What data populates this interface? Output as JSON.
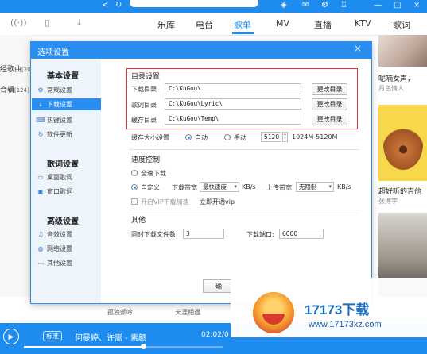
{
  "app": {
    "nav_tabs": [
      {
        "label": "乐库"
      },
      {
        "label": "电台"
      },
      {
        "label": "歌单",
        "active": true
      },
      {
        "label": "MV"
      },
      {
        "label": "直播"
      },
      {
        "label": "KTV"
      },
      {
        "label": "歌词"
      }
    ],
    "left_fragments": [
      "经歌曲",
      "合辑"
    ],
    "left_counts": [
      "[20",
      "[124]"
    ],
    "right_captions": [
      {
        "title": "呢喃女声，",
        "sub": "月色情人"
      },
      {
        "title": "超好听的吉他",
        "sub": "张博宇"
      },
      {
        "title": "",
        "sub": ""
      }
    ],
    "footer_texts": [
      "孤独颤吟",
      "天涯相遇"
    ],
    "player": {
      "quality": "标准",
      "song": "何曼婷、许嵩 - 素颜",
      "time": "02:02/0",
      "progress": 0.6
    },
    "colors": {
      "brand_blue": "#2a8ef0",
      "highlight_red": "#e53935"
    }
  },
  "dialog": {
    "title": "选项设置",
    "close_icon": "×",
    "nav_groups": [
      {
        "title": "基本设置",
        "items": [
          {
            "icon": "gear-icon",
            "label": "常规设置",
            "active": false
          },
          {
            "icon": "download-icon",
            "label": "下载设置",
            "active": true
          },
          {
            "icon": "keyboard-icon",
            "label": "热键设置",
            "active": false
          },
          {
            "icon": "refresh-icon",
            "label": "软件更新",
            "active": false
          }
        ]
      },
      {
        "title": "歌词设置",
        "items": [
          {
            "icon": "desktop-lyrics-icon",
            "label": "桌面歌词",
            "active": false
          },
          {
            "icon": "window-lyrics-icon",
            "label": "窗口歌词",
            "active": false
          }
        ]
      },
      {
        "title": "高级设置",
        "items": [
          {
            "icon": "audio-icon",
            "label": "音效设置",
            "active": false
          },
          {
            "icon": "network-icon",
            "label": "网络设置",
            "active": false
          },
          {
            "icon": "more-icon",
            "label": "其他设置",
            "active": false
          }
        ]
      }
    ],
    "directory": {
      "section_title": "目录设置",
      "rows": [
        {
          "label": "下载目录",
          "path": "C:\\KuGou\\",
          "button": "更改目录"
        },
        {
          "label": "歌词目录",
          "path": "C:\\KuGou\\Lyric\\",
          "button": "更改目录"
        },
        {
          "label": "缓存目录",
          "path": "C:\\KuGou\\Temp\\",
          "button": "更改目录"
        }
      ]
    },
    "cache_size": {
      "label": "缓存大小设置",
      "auto": "自动",
      "manual": "手动",
      "value": "5120",
      "range": "1024M-5120M"
    },
    "speed": {
      "section_title": "速度控制",
      "full_speed": "全速下载",
      "custom": "自定义",
      "download_label": "下载带宽",
      "download_value": "最快速度",
      "download_unit": "KB/s",
      "upload_label": "上传带宽",
      "upload_value": "无限制",
      "upload_unit": "KB/s",
      "vip_label": "开启VIP下载加速",
      "vip_link": "立即开通vip"
    },
    "other": {
      "section_title": "其他",
      "concurrent_label": "同时下载文件数:",
      "concurrent_value": "3",
      "port_label": "下载端口:",
      "port_value": "6000"
    },
    "ok_button": "确"
  },
  "watermark": {
    "title": "17173下载",
    "url": "www.17173xz.com"
  }
}
